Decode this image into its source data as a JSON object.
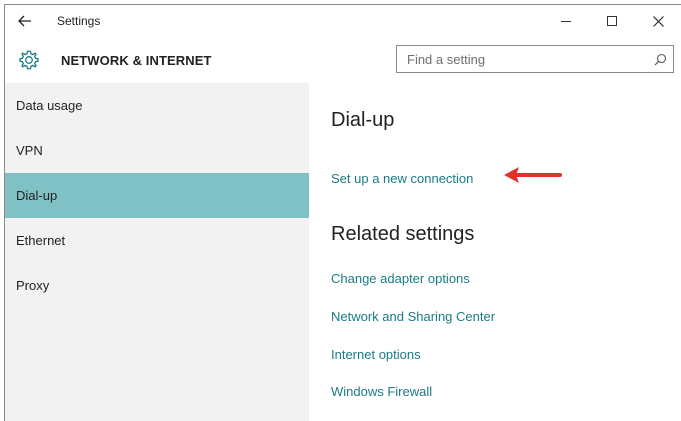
{
  "window": {
    "title": "Settings"
  },
  "header": {
    "section_title": "NETWORK & INTERNET",
    "search_placeholder": "Find a setting"
  },
  "sidebar": {
    "items": [
      {
        "label": "Data usage",
        "active": false
      },
      {
        "label": "VPN",
        "active": false
      },
      {
        "label": "Dial-up",
        "active": true
      },
      {
        "label": "Ethernet",
        "active": false
      },
      {
        "label": "Proxy",
        "active": false
      }
    ]
  },
  "content": {
    "heading": "Dial-up",
    "setup_link": "Set up a new connection",
    "related_heading": "Related settings",
    "related_links": [
      "Change adapter options",
      "Network and Sharing Center",
      "Internet options",
      "Windows Firewall"
    ]
  },
  "colors": {
    "active_nav": "#80c1c6",
    "link": "#1b7b85",
    "annotation_arrow": "#e0322b"
  },
  "icons": {
    "back": "back-arrow-icon",
    "settings": "gear-icon",
    "search": "search-icon",
    "annotation": "red-arrow-icon"
  }
}
